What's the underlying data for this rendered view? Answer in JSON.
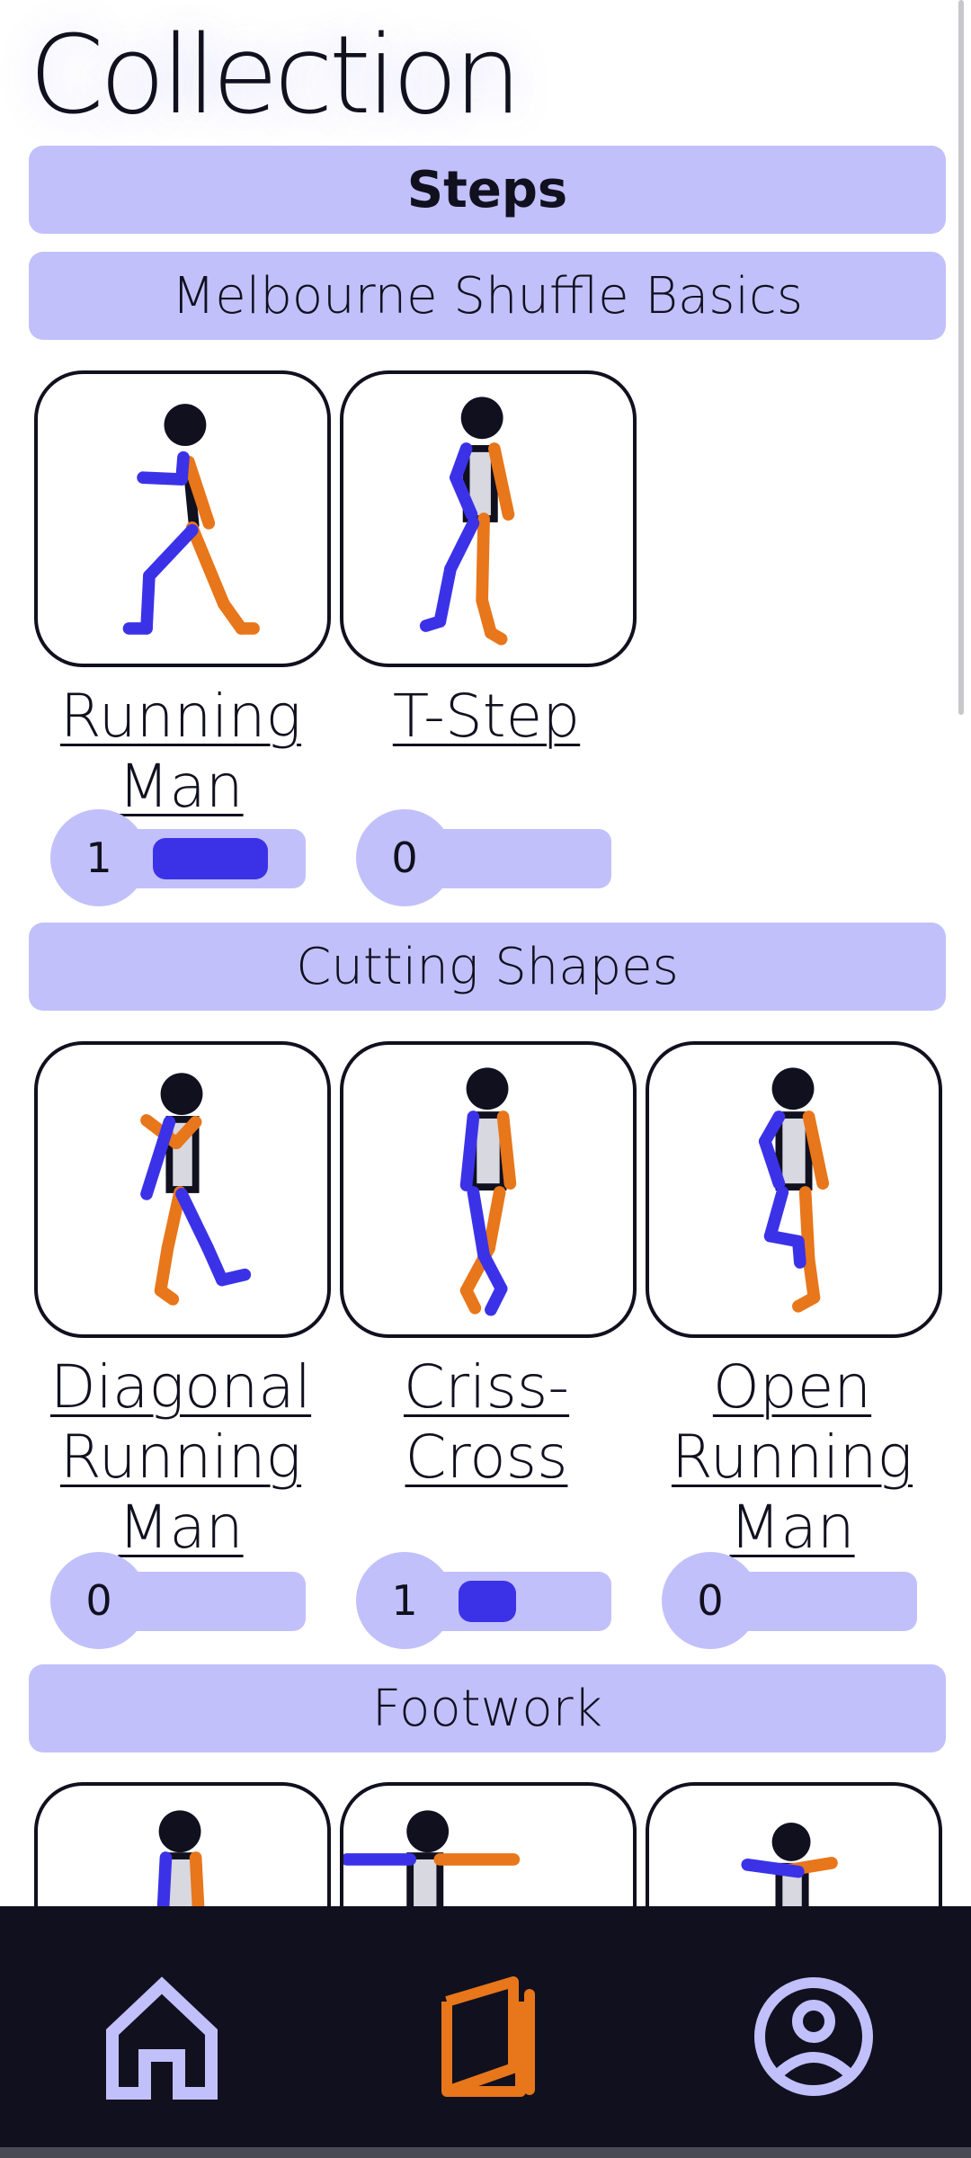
{
  "page": {
    "title": "Collection"
  },
  "tabs": {
    "active": "Steps"
  },
  "colors": {
    "accent": "#3b32e8",
    "accent_light": "#c2c0fb",
    "orange": "#e8761a",
    "dark": "#11101f"
  },
  "sections": [
    {
      "title": "Melbourne Shuffle Basics",
      "steps": [
        {
          "name_lines": [
            "Running",
            "Man"
          ],
          "count": "1",
          "progress": 0.8,
          "icon": "running-man-figure"
        },
        {
          "name_lines": [
            "T-Step"
          ],
          "count": "0",
          "progress": 0,
          "icon": "t-step-figure"
        }
      ]
    },
    {
      "title": "Cutting Shapes",
      "steps": [
        {
          "name_lines": [
            "Diagonal",
            "Running",
            "Man"
          ],
          "count": "0",
          "progress": 0,
          "icon": "diagonal-running-man-figure"
        },
        {
          "name_lines": [
            "Criss-",
            "Cross"
          ],
          "count": "1",
          "progress": 0.4,
          "icon": "criss-cross-figure"
        },
        {
          "name_lines": [
            "Open",
            "Running",
            "Man"
          ],
          "count": "0",
          "progress": 0,
          "icon": "open-running-man-figure"
        }
      ]
    },
    {
      "title": "Footwork",
      "steps": [
        {
          "icon": "footwork-figure-1"
        },
        {
          "icon": "footwork-figure-2"
        },
        {
          "icon": "footwork-figure-3"
        }
      ]
    }
  ],
  "nav": {
    "items": [
      {
        "icon": "home-icon",
        "active": false
      },
      {
        "icon": "book-icon",
        "active": true
      },
      {
        "icon": "profile-icon",
        "active": false
      }
    ]
  }
}
